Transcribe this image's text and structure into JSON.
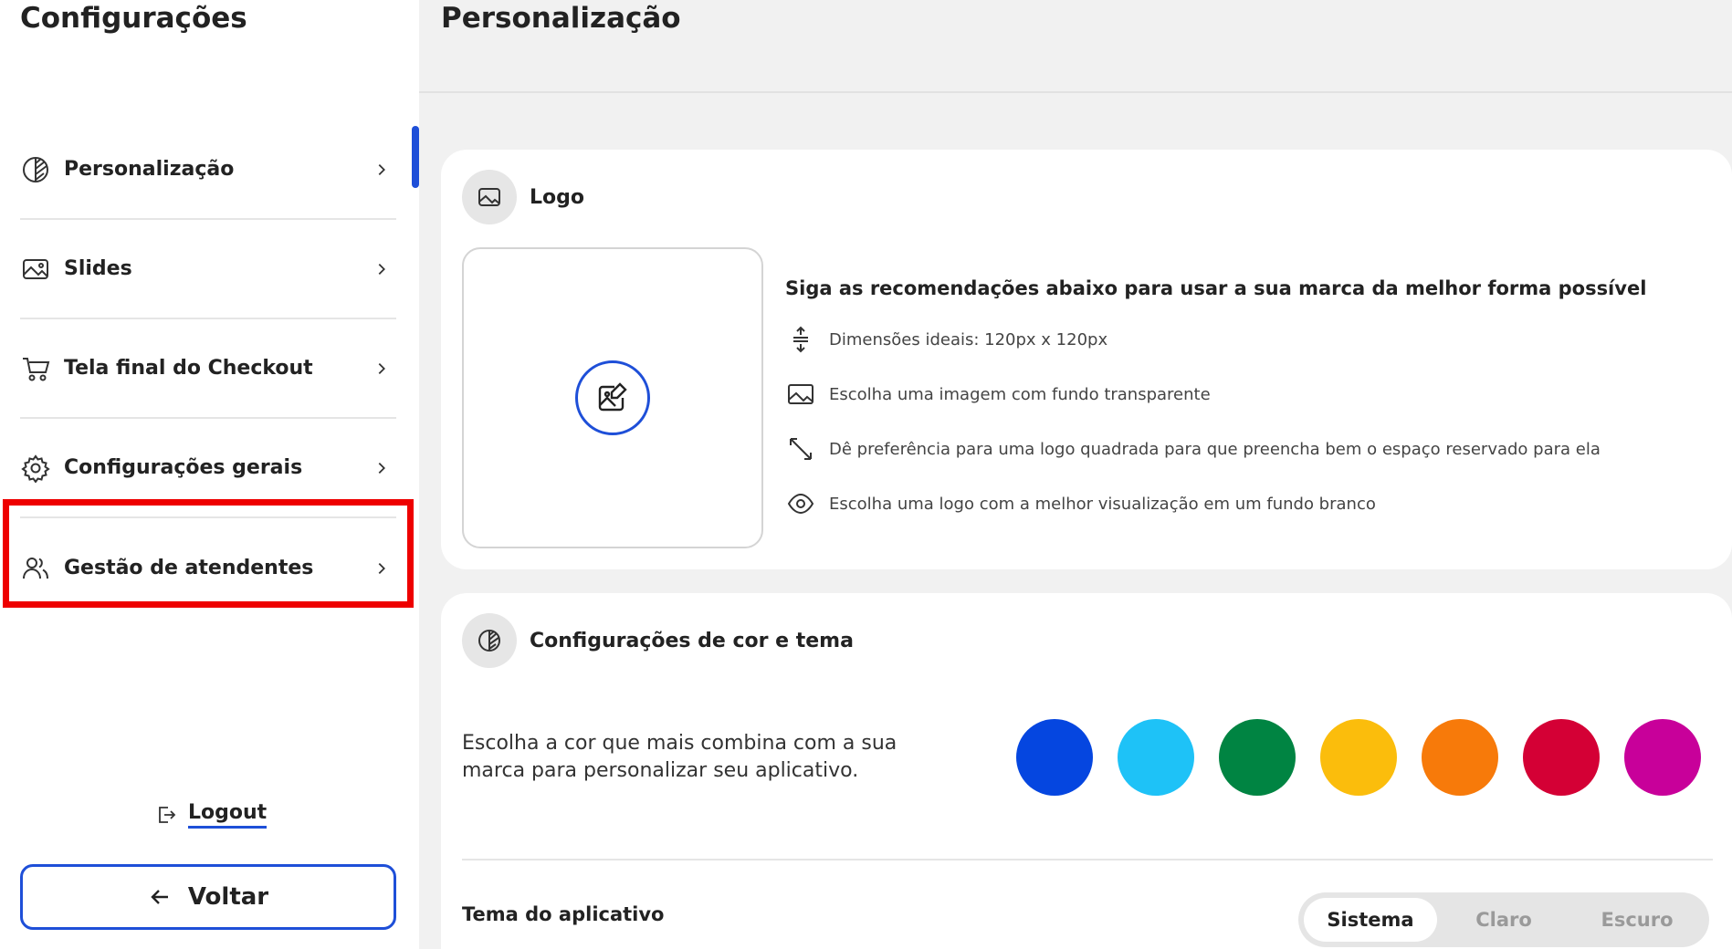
{
  "sidebar": {
    "title": "Configurações",
    "items": [
      {
        "label": "Personalização",
        "icon": "palette-icon"
      },
      {
        "label": "Slides",
        "icon": "image-icon"
      },
      {
        "label": "Tela final do Checkout",
        "icon": "cart-icon"
      },
      {
        "label": "Configurações gerais",
        "icon": "gear-icon"
      },
      {
        "label": "Gestão de atendentes",
        "icon": "users-icon"
      }
    ],
    "logout_label": "Logout",
    "back_label": "Voltar"
  },
  "main": {
    "page_title": "Personalização",
    "logo_card": {
      "title": "Logo",
      "recommendations_title": "Siga as recomendações abaixo para usar a sua marca da melhor forma possível",
      "recommendations": [
        {
          "icon": "dimensions-icon",
          "text": "Dimensões ideais: 120px x 120px"
        },
        {
          "icon": "image-icon",
          "text": "Escolha uma imagem com fundo transparente"
        },
        {
          "icon": "expand-icon",
          "text": "Dê preferência para uma logo quadrada para que preencha bem o espaço reservado para ela"
        },
        {
          "icon": "eye-icon",
          "text": "Escolha uma logo com a melhor visualização em um fundo branco"
        }
      ]
    },
    "color_card": {
      "title": "Configurações de cor e tema",
      "description": "Escolha a cor que mais combina com a sua marca para personalizar seu aplicativo.",
      "swatches": [
        "#0546e0",
        "#1ec2f7",
        "#008442",
        "#fbbd0c",
        "#f77a0a",
        "#d40035",
        "#c8009a"
      ],
      "theme_label": "Tema do aplicativo",
      "theme_options": [
        "Sistema",
        "Claro",
        "Escuro"
      ],
      "theme_selected": "Sistema"
    }
  },
  "colors": {
    "accent": "#1e4fd8",
    "highlight": "#ee0000"
  }
}
